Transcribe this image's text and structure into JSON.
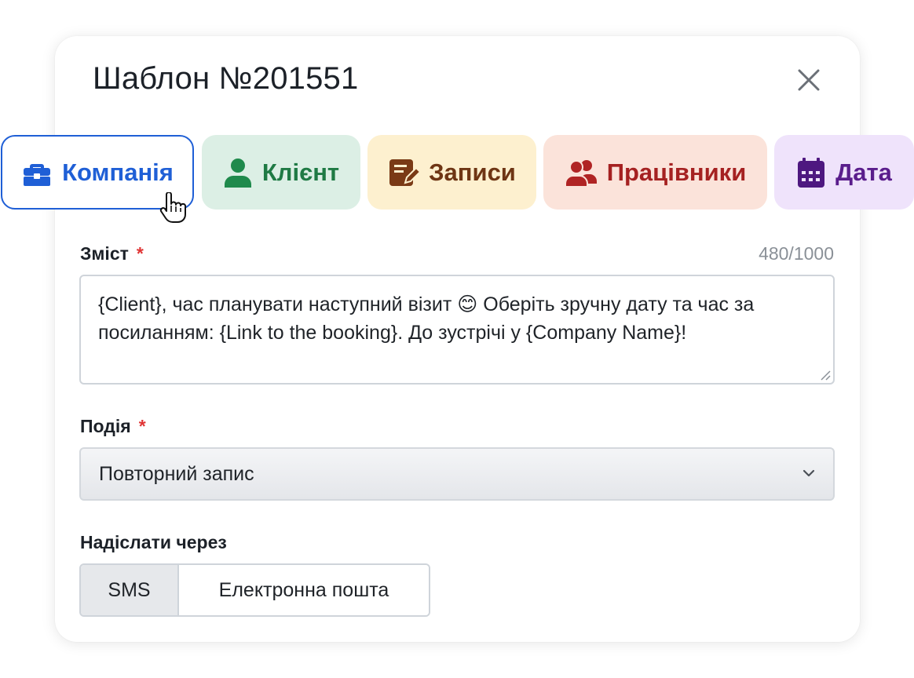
{
  "dialog": {
    "title": "Шаблон №201551"
  },
  "variable_chips": [
    {
      "label": "Компанія",
      "icon": "briefcase-icon",
      "color": "#1f5fd6",
      "selected": true
    },
    {
      "label": "Клієнт",
      "icon": "user-icon",
      "color": "#1f7a44"
    },
    {
      "label": "Записи",
      "icon": "edit-note-icon",
      "color": "#6e3514"
    },
    {
      "label": "Працівники",
      "icon": "users-icon",
      "color": "#a52121"
    },
    {
      "label": "Дата",
      "icon": "calendar-icon",
      "color": "#5a1d8c"
    }
  ],
  "content": {
    "label": "Зміст",
    "required_mark": "*",
    "counter": "480/1000",
    "value_start": "{Client}, час планувати наступний візит ",
    "emoji": "😊",
    "value_end": " Оберіть зручну дату та час за посиланням: {Link to the booking}. До зустрічі у {Company Name}!"
  },
  "event": {
    "label": "Подія",
    "required_mark": "*",
    "selected": "Повторний запис"
  },
  "send_via": {
    "label": "Надіслати через",
    "options": [
      "SMS",
      "Електронна пошта"
    ],
    "selected": "SMS"
  }
}
